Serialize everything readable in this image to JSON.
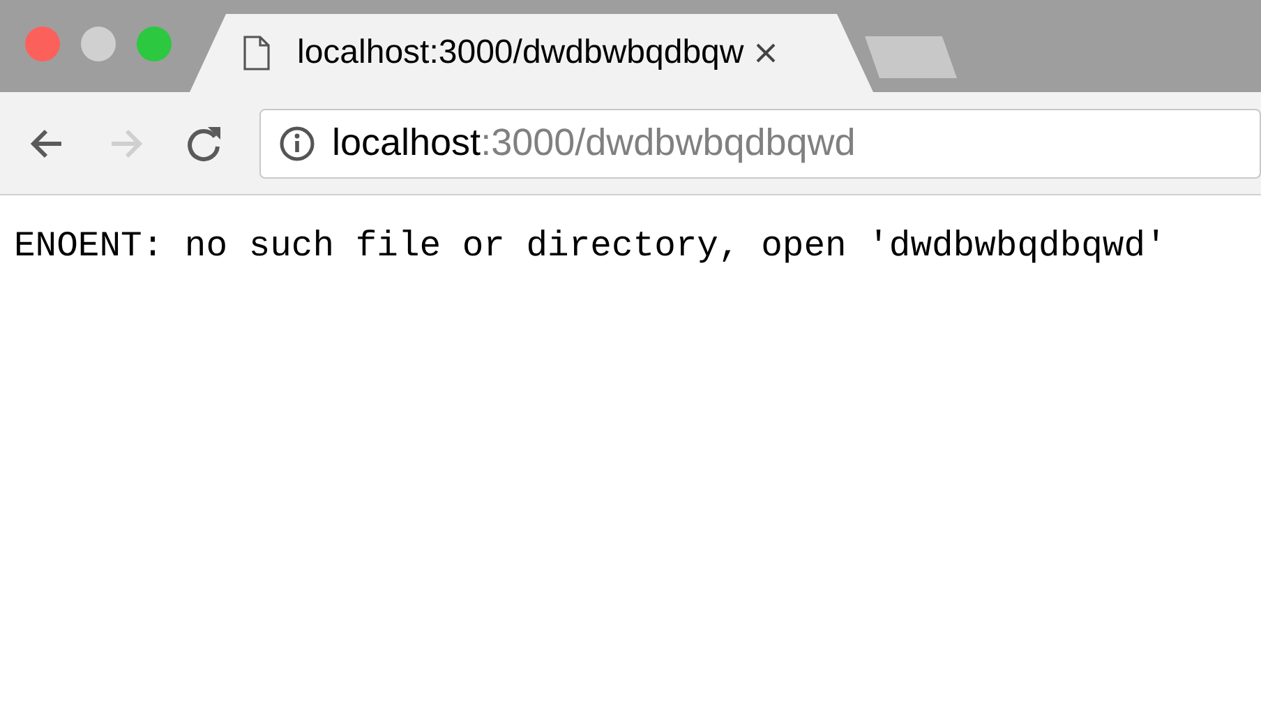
{
  "window": {
    "controls": [
      {
        "color": "#fc605b"
      },
      {
        "color": "#d0d0d0"
      },
      {
        "color": "#2bc840"
      }
    ]
  },
  "tabs": [
    {
      "title": "localhost:3000/dwdbwbqdbqw",
      "selected": true
    }
  ],
  "toolbar": {
    "buttons": [
      {
        "kind": "back",
        "disabled": false
      },
      {
        "kind": "forward",
        "disabled": true
      },
      {
        "kind": "reload",
        "disabled": false
      }
    ],
    "address": {
      "host": "localhost",
      "rest": ":3000/dwdbwbqdbqwd"
    }
  },
  "page": {
    "message": "ENOENT: no such file or directory, open 'dwdbwbqdbqwd'"
  }
}
